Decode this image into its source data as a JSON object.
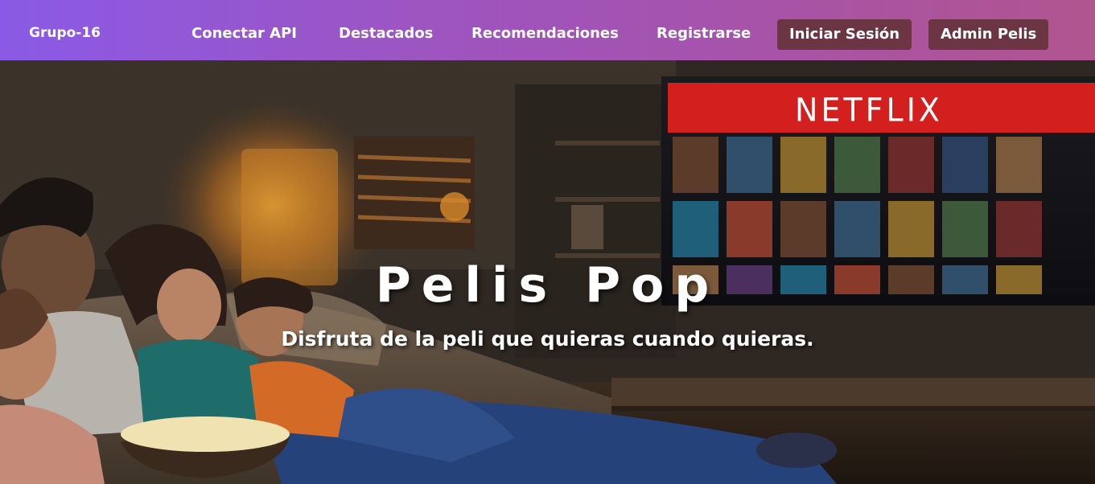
{
  "navbar": {
    "brand": "Grupo-16",
    "links": [
      "Conectar API",
      "Destacados",
      "Recomendaciones",
      "Registrarse"
    ],
    "buttons": [
      "Iniciar Sesión",
      "Admin Pelis"
    ]
  },
  "hero": {
    "title": "Pelis Pop",
    "subtitle": "Disfruta de la peli que quieras cuando quieras.",
    "tv_logo": "NETFLIX",
    "image_description_icon": "family-watching-tv-image"
  },
  "colors": {
    "nav_gradient_start": "#8a5ae6",
    "nav_gradient_end": "#b1558f",
    "button_bg": "#6b3543",
    "netflix_red": "#d41f1f"
  }
}
